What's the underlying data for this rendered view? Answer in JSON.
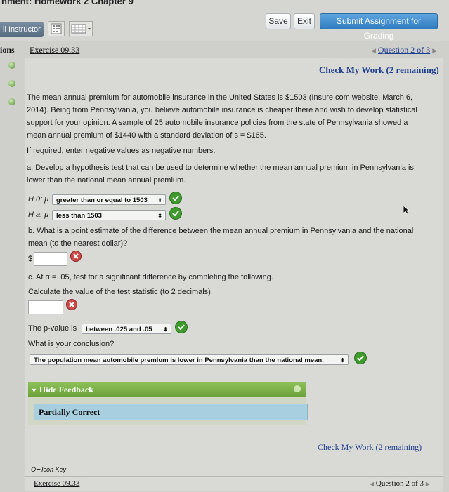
{
  "header": {
    "title": "nment: Homework 2 Chapter 9",
    "instructor_label": "il Instructor",
    "save_label": "Save",
    "exit_label": "Exit",
    "submit_label": "Submit Assignment for Grading"
  },
  "nav": {
    "left_tab": "ions",
    "exercise": "Exercise 09.33",
    "question_nav": "Question 2 of 3"
  },
  "content": {
    "check_work": "Check My Work (2 remaining)",
    "intro_line1": "The mean annual premium for automobile insurance in the United States is $1503 (Insure.com website, March 6,",
    "intro_line2": "2014). Being from Pennsylvania, you believe automobile insurance is cheaper there and wish to develop statistical",
    "intro_line3": "support for your opinion. A sample of 25 automobile insurance policies from the state of Pennsylvania showed a",
    "intro_line4": "mean annual premium of $1440 with a standard deviation of s = $165.",
    "negative_note": "If required, enter negative values as negative numbers.",
    "part_a_line1": "a. Develop a hypothesis test that can be used to determine whether the mean annual premium in Pennsylvania is",
    "part_a_line2": "lower than the national mean annual premium.",
    "h0_label": "H 0: μ",
    "h0_value": "greater than or equal to 1503",
    "ha_label": "H a: μ",
    "ha_value": "less than 1503",
    "part_b_line1": "b. What is a point estimate of the difference between the mean annual premium in Pennsylvania and the national",
    "part_b_line2": "mean (to the nearest dollar)?",
    "dollar_sign": "$",
    "part_c": "c. At α = .05, test for a significant difference by completing the following.",
    "calc_stat": "Calculate the value of the test statistic (to 2 decimals).",
    "pvalue_label": "The p-value is",
    "pvalue_value": "between .025 and .05",
    "conclusion_q": "What is your conclusion?",
    "conclusion_value": "The population mean automobile premium is lower in Pennsylvania than the national mean.",
    "hide_feedback": "Hide Feedback",
    "feedback_status": "Partially Correct",
    "check_work_bottom": "Check My Work (2 remaining)",
    "icon_key": "Icon Key",
    "exercise_bottom": "Exercise 09.33",
    "question_nav_bottom": "Question 2 of 3"
  },
  "colors": {
    "accent_blue": "#2f7cc0",
    "correct_green": "#3f9a2e",
    "incorrect_red": "#c94a4a",
    "feedback_bar": "#7cb048"
  }
}
